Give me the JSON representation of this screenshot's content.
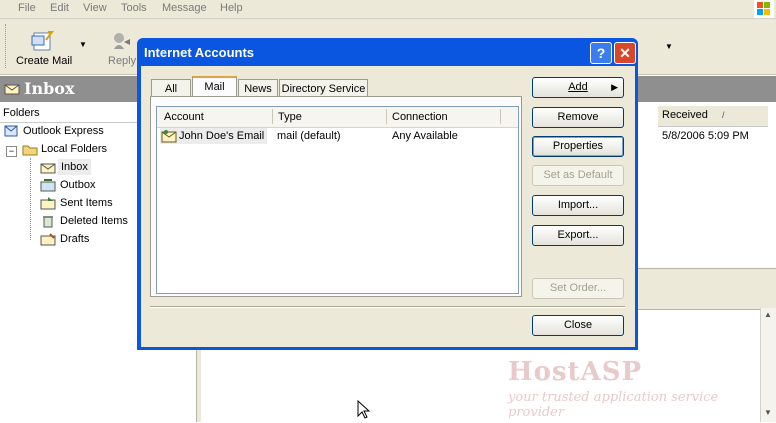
{
  "menu": [
    "File",
    "Edit",
    "View",
    "Tools",
    "Message",
    "Help"
  ],
  "toolbar": {
    "create_mail": "Create Mail",
    "reply": "Reply"
  },
  "inbox": {
    "title": "Inbox"
  },
  "folders": {
    "header": "Folders",
    "items": [
      "Outlook Express",
      "Local Folders",
      "Inbox",
      "Outbox",
      "Sent Items",
      "Deleted Items",
      "Drafts"
    ]
  },
  "message_list": {
    "received_header": "Received",
    "sort_glyph": "/",
    "first_received": "5/8/2006 5:09 PM"
  },
  "dialog": {
    "title": "Internet Accounts",
    "help_glyph": "?",
    "close_glyph": "✕",
    "tabs": [
      "All",
      "Mail",
      "News",
      "Directory Service"
    ],
    "active_tab": "Mail",
    "columns": [
      "Account",
      "Type",
      "Connection"
    ],
    "rows": [
      {
        "account": "John Doe's Email",
        "type": "mail (default)",
        "connection": "Any Available"
      }
    ],
    "buttons": {
      "add": "Add",
      "add_arrow": "▶",
      "remove": "Remove",
      "properties": "Properties",
      "set_default": "Set as Default",
      "import": "Import...",
      "export": "Export...",
      "set_order": "Set Order...",
      "close": "Close"
    }
  },
  "watermark": {
    "brand": "HostASP",
    "tagline": "your trusted application service provider"
  }
}
